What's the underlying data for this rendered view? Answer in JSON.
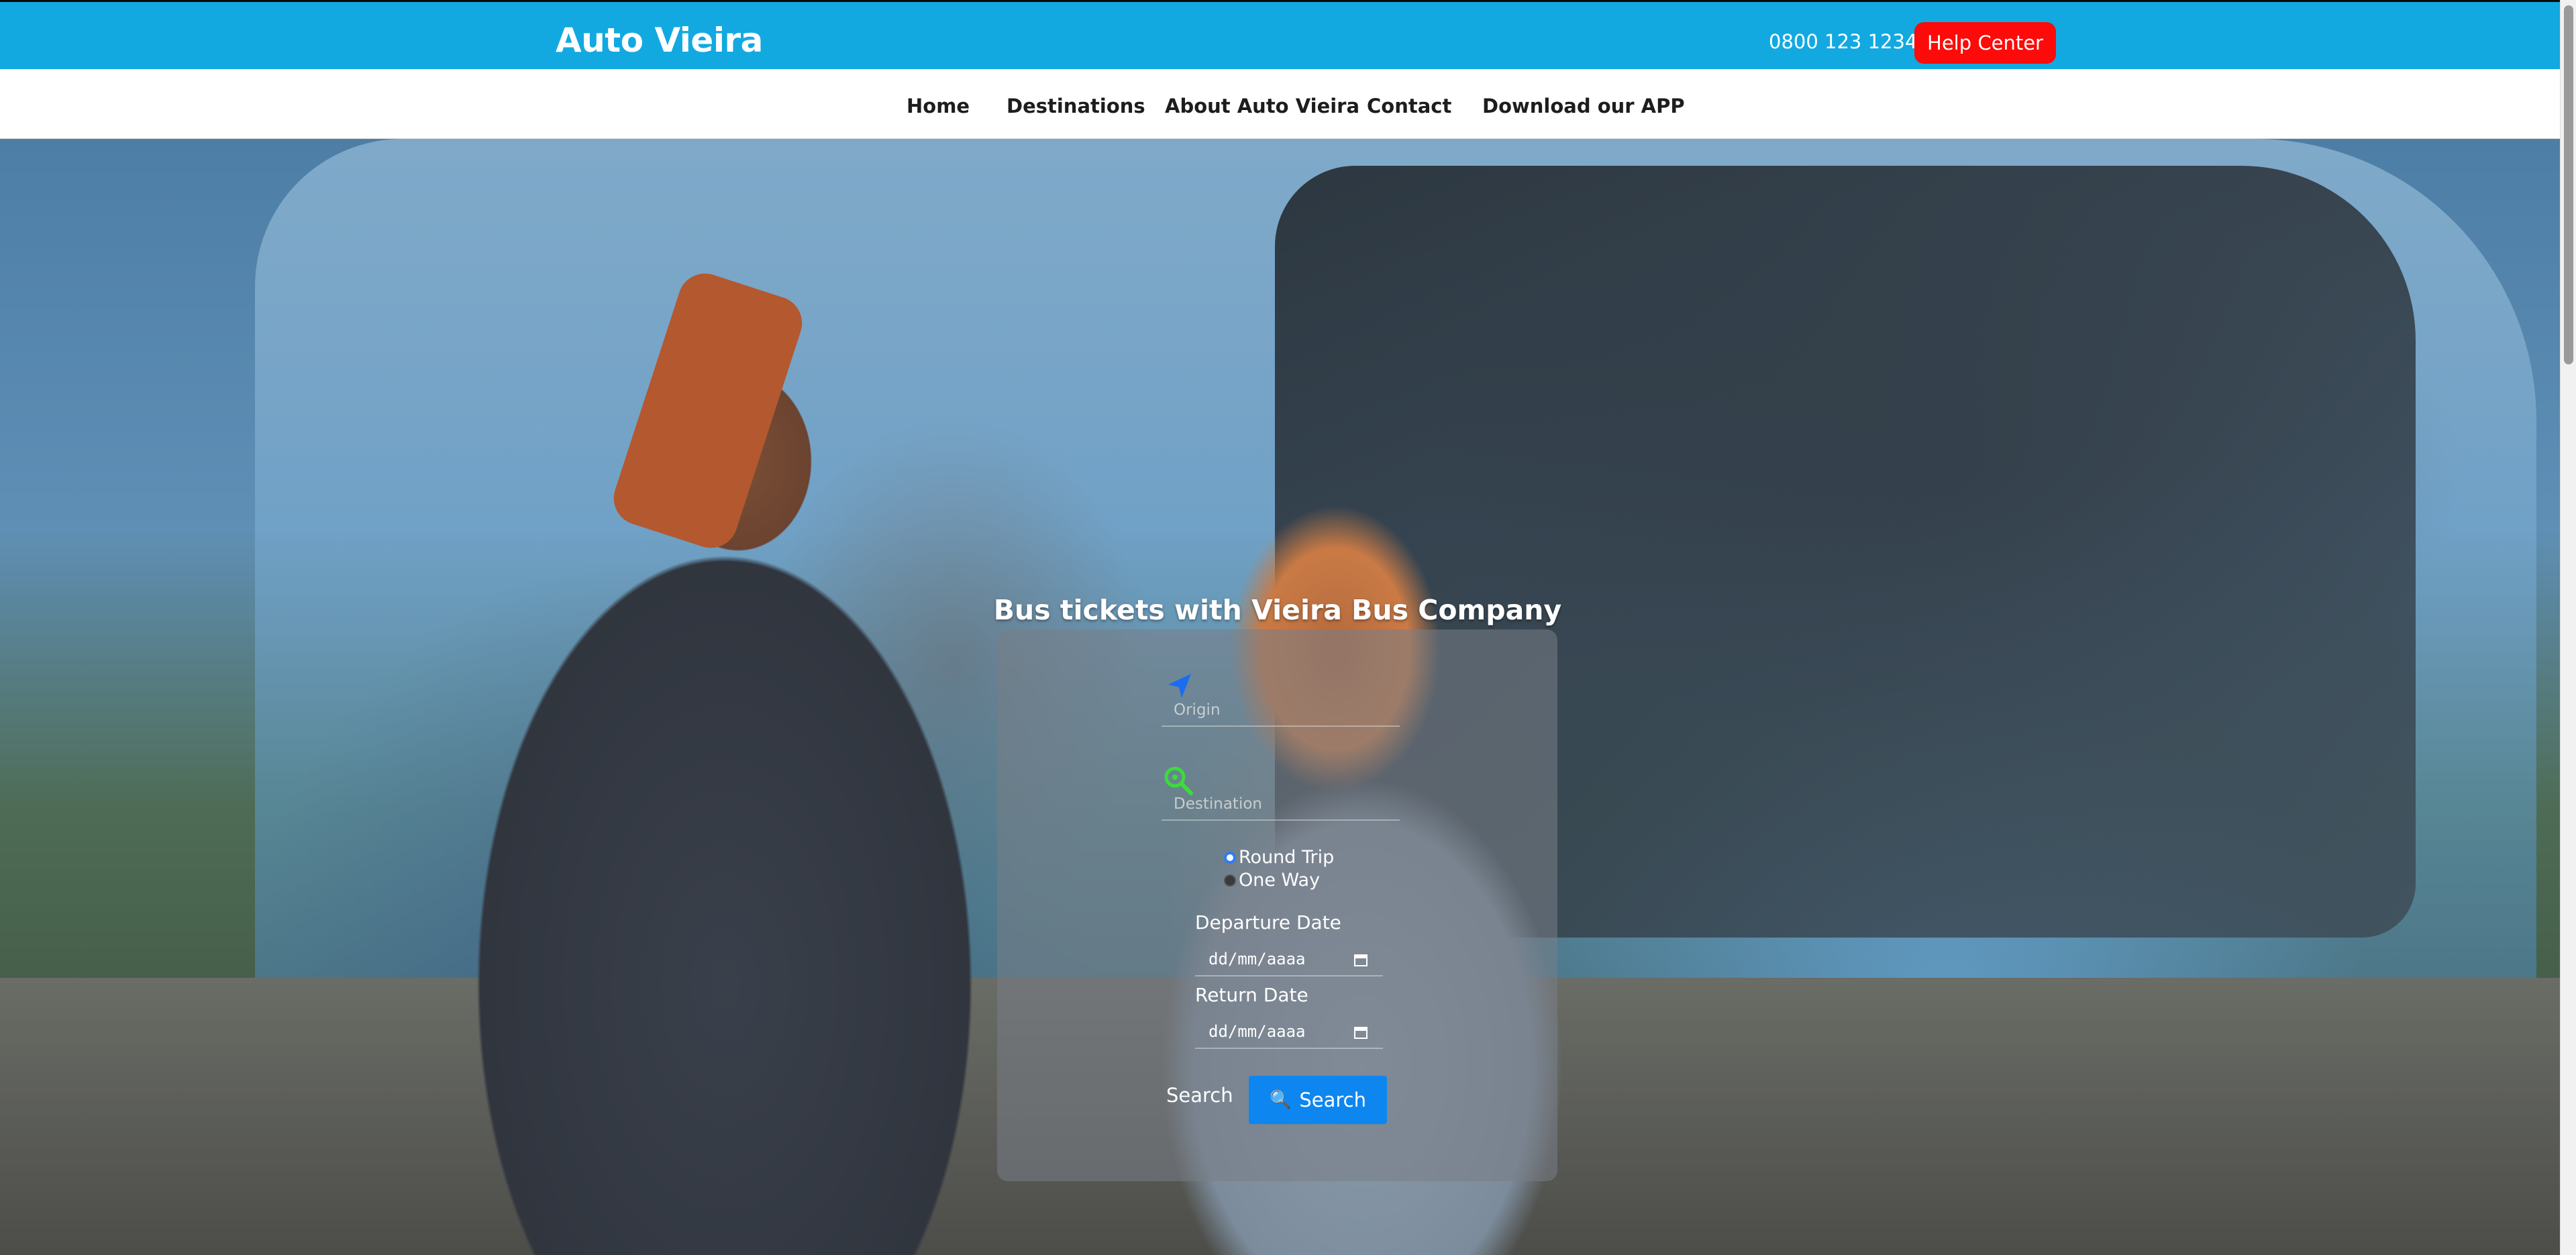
{
  "header": {
    "brand": "Auto Vieira",
    "phone": "0800 123 1234",
    "help_label": "Help Center",
    "brand_color": "#12a9e1",
    "help_color": "#ff0a0a"
  },
  "nav": {
    "items": [
      {
        "label": "Home"
      },
      {
        "label": "Destinations"
      },
      {
        "label": "About Auto Vieira"
      },
      {
        "label": "Contact"
      },
      {
        "label": "Download our APP"
      }
    ]
  },
  "hero": {
    "title": "Bus tickets with Vieira Bus Company",
    "image_icon": "photo-couple-selfie-bus"
  },
  "booking": {
    "origin": {
      "placeholder": "Origin",
      "icon": "navigation-arrow-icon"
    },
    "destination": {
      "placeholder": "Destination",
      "icon": "search-location-icon"
    },
    "trip_type": {
      "options": [
        {
          "label": "Round Trip",
          "selected": true
        },
        {
          "label": "One Way",
          "selected": false
        }
      ]
    },
    "departure": {
      "label": "Departure Date",
      "placeholder": "dd/mm/aaaa"
    },
    "return": {
      "label": "Return Date",
      "placeholder": "dd/mm/aaaa"
    },
    "search_text": "Search",
    "search_button": "Search",
    "search_button_icon": "magnifier-icon",
    "button_color": "#0e86f0"
  }
}
